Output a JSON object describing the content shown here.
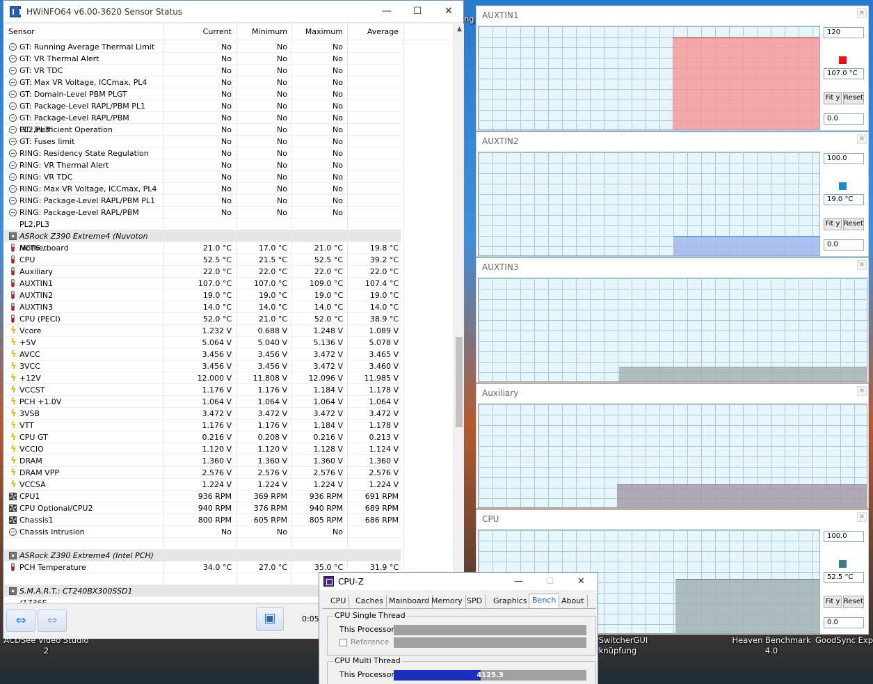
{
  "desktop": {
    "icons": [
      {
        "label": "ACDSee Video Studio",
        "label2": "2"
      },
      {
        "label": "rSwitcherGUI",
        "label2": "rknüpfung"
      },
      {
        "label": "Heaven Benchmark",
        "label2": "4.0"
      },
      {
        "label": "GoodSync Explo",
        "label2": ""
      }
    ],
    "partial_text": "ng"
  },
  "hwinfo": {
    "title": "HWiNFO64 v6.00-3620 Sensor Status",
    "headers": [
      "Sensor",
      "Current",
      "Minimum",
      "Maximum",
      "Average"
    ],
    "rows": [
      {
        "icon": "circle",
        "name": "GT: Running Average Thermal Limit",
        "cur": "No",
        "min": "No",
        "max": "No",
        "avg": ""
      },
      {
        "icon": "circle",
        "name": "GT: VR Thermal Alert",
        "cur": "No",
        "min": "No",
        "max": "No",
        "avg": ""
      },
      {
        "icon": "circle",
        "name": "GT: VR TDC",
        "cur": "No",
        "min": "No",
        "max": "No",
        "avg": ""
      },
      {
        "icon": "circle",
        "name": "GT: Max VR Voltage, ICCmax, PL4",
        "cur": "No",
        "min": "No",
        "max": "No",
        "avg": ""
      },
      {
        "icon": "circle",
        "name": "GT: Domain-Level PBM PLGT",
        "cur": "No",
        "min": "No",
        "max": "No",
        "avg": ""
      },
      {
        "icon": "circle",
        "name": "GT: Package-Level RAPL/PBM PL1",
        "cur": "No",
        "min": "No",
        "max": "No",
        "avg": ""
      },
      {
        "icon": "circle",
        "name": "GT: Package-Level RAPL/PBM PL2,PL3",
        "cur": "No",
        "min": "No",
        "max": "No",
        "avg": ""
      },
      {
        "icon": "circle",
        "name": "GT: Inefficient Operation",
        "cur": "No",
        "min": "No",
        "max": "No",
        "avg": ""
      },
      {
        "icon": "circle",
        "name": "GT: Fuses limit",
        "cur": "No",
        "min": "No",
        "max": "No",
        "avg": ""
      },
      {
        "icon": "circle",
        "name": "RING: Residency State Regulation",
        "cur": "No",
        "min": "No",
        "max": "No",
        "avg": ""
      },
      {
        "icon": "circle",
        "name": "RING: VR Thermal Alert",
        "cur": "No",
        "min": "No",
        "max": "No",
        "avg": ""
      },
      {
        "icon": "circle",
        "name": "RING: VR TDC",
        "cur": "No",
        "min": "No",
        "max": "No",
        "avg": ""
      },
      {
        "icon": "circle",
        "name": "RING: Max VR Voltage, ICCmax, PL4",
        "cur": "No",
        "min": "No",
        "max": "No",
        "avg": ""
      },
      {
        "icon": "circle",
        "name": "RING: Package-Level RAPL/PBM PL1",
        "cur": "No",
        "min": "No",
        "max": "No",
        "avg": ""
      },
      {
        "icon": "circle",
        "name": "RING: Package-Level RAPL/PBM PL2,PL3",
        "cur": "No",
        "min": "No",
        "max": "No",
        "avg": ""
      },
      {
        "icon": "none",
        "name": "",
        "cur": "",
        "min": "",
        "max": "",
        "avg": ""
      },
      {
        "icon": "chip",
        "group": true,
        "name": "ASRock Z390 Extreme4 (Nuvoton NCT6...",
        "cur": "",
        "min": "",
        "max": "",
        "avg": ""
      },
      {
        "icon": "temp",
        "name": "Motherboard",
        "cur": "21.0 °C",
        "min": "17.0 °C",
        "max": "21.0 °C",
        "avg": "19.8 °C"
      },
      {
        "icon": "temp",
        "name": "CPU",
        "cur": "52.5 °C",
        "min": "21.5 °C",
        "max": "52.5 °C",
        "avg": "39.2 °C"
      },
      {
        "icon": "temp",
        "name": "Auxiliary",
        "cur": "22.0 °C",
        "min": "22.0 °C",
        "max": "22.0 °C",
        "avg": "22.0 °C"
      },
      {
        "icon": "temp",
        "name": "AUXTIN1",
        "cur": "107.0 °C",
        "min": "107.0 °C",
        "max": "109.0 °C",
        "avg": "107.4 °C"
      },
      {
        "icon": "temp",
        "name": "AUXTIN2",
        "cur": "19.0 °C",
        "min": "19.0 °C",
        "max": "19.0 °C",
        "avg": "19.0 °C"
      },
      {
        "icon": "temp",
        "name": "AUXTIN3",
        "cur": "14.0 °C",
        "min": "14.0 °C",
        "max": "14.0 °C",
        "avg": "14.0 °C"
      },
      {
        "icon": "temp",
        "name": "CPU (PECI)",
        "cur": "52.0 °C",
        "min": "21.0 °C",
        "max": "52.0 °C",
        "avg": "38.9 °C"
      },
      {
        "icon": "volt",
        "name": "Vcore",
        "cur": "1.232 V",
        "min": "0.688 V",
        "max": "1.248 V",
        "avg": "1.089 V"
      },
      {
        "icon": "volt",
        "name": "+5V",
        "cur": "5.064 V",
        "min": "5.040 V",
        "max": "5.136 V",
        "avg": "5.078 V"
      },
      {
        "icon": "volt",
        "name": "AVCC",
        "cur": "3.456 V",
        "min": "3.456 V",
        "max": "3.472 V",
        "avg": "3.465 V"
      },
      {
        "icon": "volt",
        "name": "3VCC",
        "cur": "3.456 V",
        "min": "3.456 V",
        "max": "3.472 V",
        "avg": "3.460 V"
      },
      {
        "icon": "volt",
        "name": "+12V",
        "cur": "12.000 V",
        "min": "11.808 V",
        "max": "12.096 V",
        "avg": "11.985 V"
      },
      {
        "icon": "volt",
        "name": "VCCST",
        "cur": "1.176 V",
        "min": "1.176 V",
        "max": "1.184 V",
        "avg": "1.178 V"
      },
      {
        "icon": "volt",
        "name": "PCH +1.0V",
        "cur": "1.064 V",
        "min": "1.064 V",
        "max": "1.064 V",
        "avg": "1.064 V"
      },
      {
        "icon": "volt",
        "name": "3VSB",
        "cur": "3.472 V",
        "min": "3.472 V",
        "max": "3.472 V",
        "avg": "3.472 V"
      },
      {
        "icon": "volt",
        "name": "VTT",
        "cur": "1.176 V",
        "min": "1.176 V",
        "max": "1.184 V",
        "avg": "1.178 V"
      },
      {
        "icon": "volt",
        "name": "CPU GT",
        "cur": "0.216 V",
        "min": "0.208 V",
        "max": "0.216 V",
        "avg": "0.213 V"
      },
      {
        "icon": "volt",
        "name": "VCCIO",
        "cur": "1.120 V",
        "min": "1.120 V",
        "max": "1.128 V",
        "avg": "1.124 V"
      },
      {
        "icon": "volt",
        "name": "DRAM",
        "cur": "1.360 V",
        "min": "1.360 V",
        "max": "1.360 V",
        "avg": "1.360 V"
      },
      {
        "icon": "volt",
        "name": "DRAM VPP",
        "cur": "2.576 V",
        "min": "2.576 V",
        "max": "2.576 V",
        "avg": "2.576 V"
      },
      {
        "icon": "volt",
        "name": "VCCSA",
        "cur": "1.224 V",
        "min": "1.224 V",
        "max": "1.224 V",
        "avg": "1.224 V"
      },
      {
        "icon": "fan",
        "name": "CPU1",
        "cur": "936 RPM",
        "min": "369 RPM",
        "max": "936 RPM",
        "avg": "691 RPM"
      },
      {
        "icon": "fan",
        "name": "CPU Optional/CPU2",
        "cur": "940 RPM",
        "min": "376 RPM",
        "max": "940 RPM",
        "avg": "689 RPM"
      },
      {
        "icon": "fan",
        "name": "Chassis1",
        "cur": "800 RPM",
        "min": "605 RPM",
        "max": "805 RPM",
        "avg": "686 RPM"
      },
      {
        "icon": "circle",
        "name": "Chassis Intrusion",
        "cur": "No",
        "min": "No",
        "max": "No",
        "avg": ""
      },
      {
        "icon": "none",
        "name": "",
        "cur": "",
        "min": "",
        "max": "",
        "avg": ""
      },
      {
        "icon": "chip",
        "group": true,
        "name": "ASRock Z390 Extreme4 (Intel PCH)",
        "cur": "",
        "min": "",
        "max": "",
        "avg": ""
      },
      {
        "icon": "temp",
        "name": "PCH Temperature",
        "cur": "34.0 °C",
        "min": "27.0 °C",
        "max": "35.0 °C",
        "avg": "31.9 °C"
      },
      {
        "icon": "none",
        "name": "",
        "cur": "",
        "min": "",
        "max": "",
        "avg": ""
      },
      {
        "icon": "chip",
        "group": true,
        "name": "S.M.A.R.T.: CT240BX300SSD1 (1736E...",
        "cur": "",
        "min": "",
        "max": "",
        "avg": ""
      }
    ],
    "timer": "0:05:"
  },
  "graphs": [
    {
      "title": "AUXTIN1",
      "max": "120",
      "current": "107.0 °C",
      "min": "0.0",
      "color": "#e81010",
      "fill": "#f69a9a",
      "fill_frac": 0.892,
      "start_frac": 0.568,
      "has_controls": true
    },
    {
      "title": "AUXTIN2",
      "max": "100.0",
      "current": "19.0 °C",
      "min": "0.0",
      "color": "#1a8cc8",
      "fill": "#a4b8f0",
      "fill_frac": 0.19,
      "start_frac": 0.57,
      "has_controls": true
    },
    {
      "title": "AUXTIN3",
      "max": "",
      "current": "",
      "min": "",
      "color": "#8a9aa0",
      "fill": "#a8b2b2",
      "fill_frac": 0.14,
      "start_frac": 0.36,
      "has_controls": false
    },
    {
      "title": "Auxiliary",
      "max": "",
      "current": "",
      "min": "",
      "color": "#907088",
      "fill": "#a89aaa",
      "fill_frac": 0.22,
      "start_frac": 0.355,
      "has_controls": false
    },
    {
      "title": "CPU",
      "max": "100.0",
      "current": "52.5 °C",
      "min": "0.0",
      "color": "#3e7a80",
      "fill": "#a4b4b4",
      "fill_frac": 0.525,
      "start_frac": 0.575,
      "has_controls": true
    }
  ],
  "graph_buttons": {
    "fit": "Fit y",
    "reset": "Reset"
  },
  "cpuz": {
    "title": "CPU-Z",
    "tabs": [
      "CPU",
      "Caches",
      "Mainboard",
      "Memory",
      "SPD",
      "Graphics",
      "Bench",
      "About"
    ],
    "active_tab": "Bench",
    "single_label": "CPU Single Thread",
    "multi_label": "CPU Multi Thread",
    "this_processor": "This Processor",
    "reference": "Reference",
    "multi_value": "4125.3",
    "multi_frac": 0.45
  }
}
